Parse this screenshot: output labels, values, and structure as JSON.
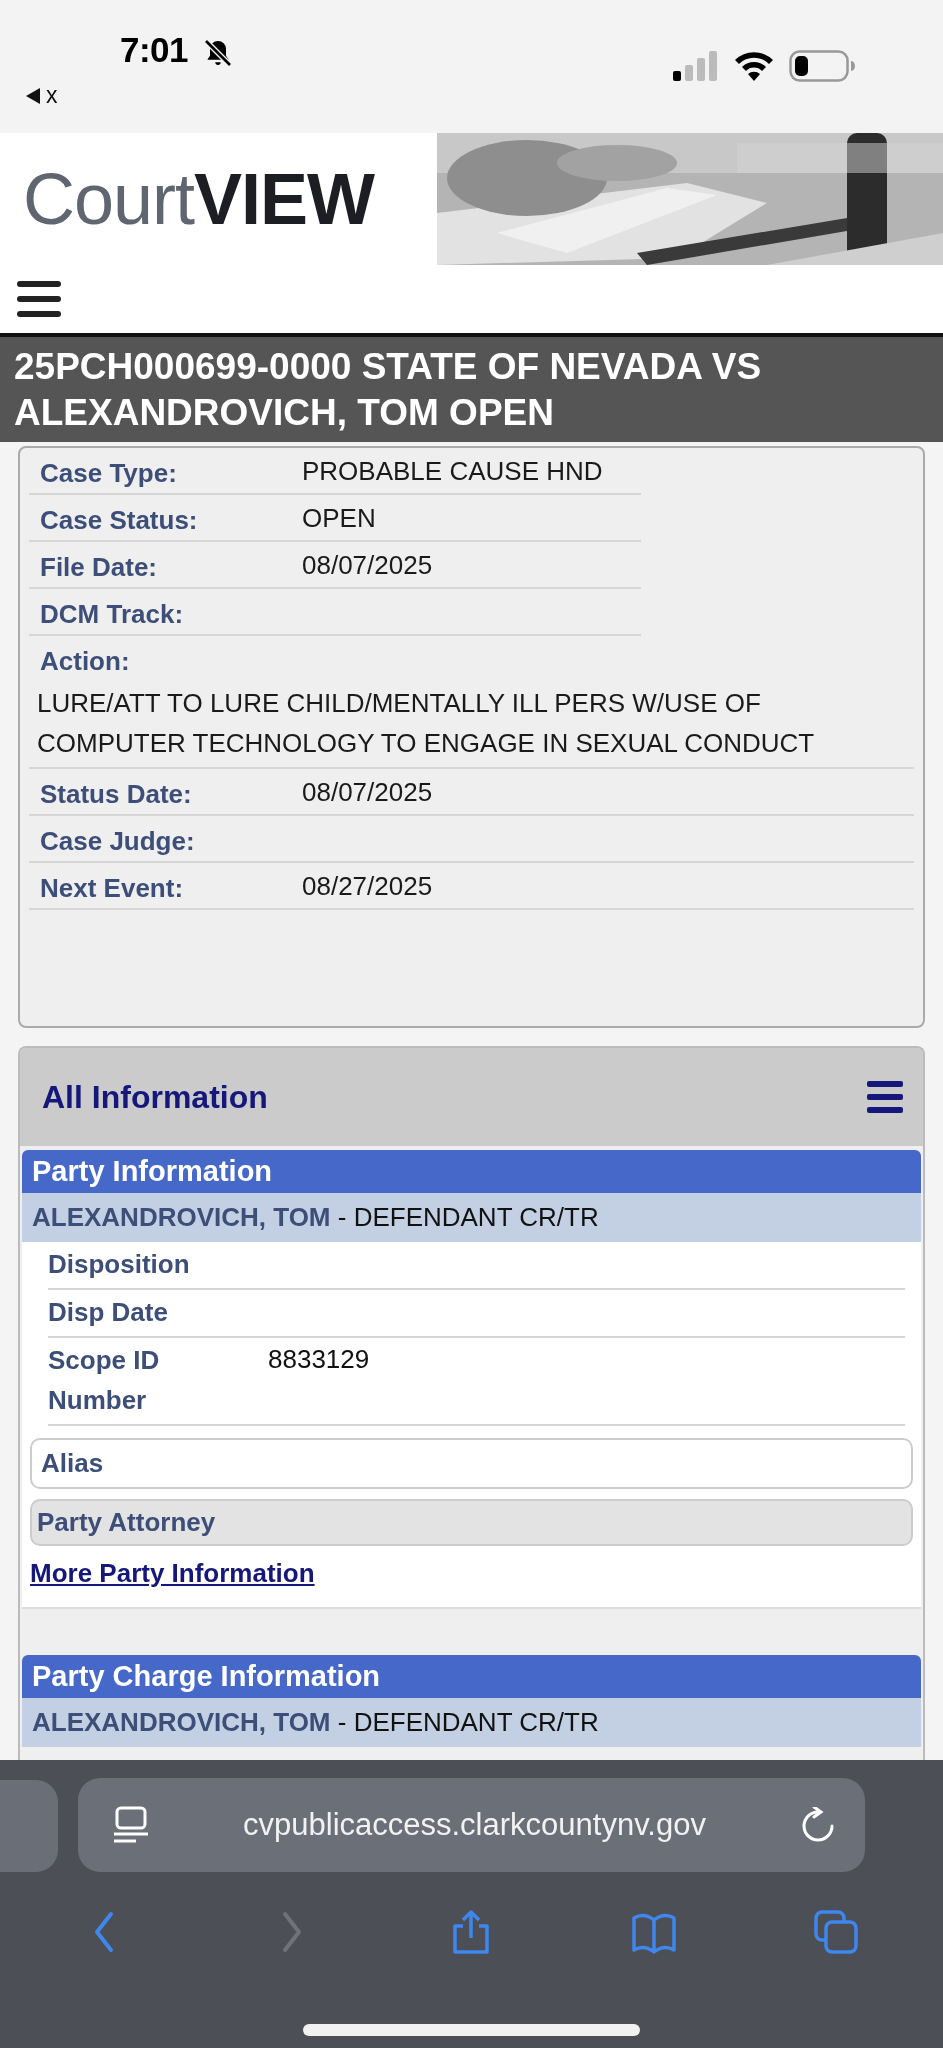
{
  "status_bar": {
    "time": "7:01",
    "back_app": "x"
  },
  "header": {
    "logo": "Court**VIEW**"
  },
  "case_title": "25PCH000699-0000 STATE OF NEVADA VS ALEXANDROVICH, TOM OPEN",
  "case_details": [
    {
      "kind": "short",
      "label": "Case Type:",
      "value": "PROBABLE CAUSE HND"
    },
    {
      "kind": "short",
      "label": "Case Status:",
      "value": "OPEN"
    },
    {
      "kind": "short",
      "label": "File Date:",
      "value": "08/07/2025"
    },
    {
      "kind": "short",
      "label": "DCM Track:"
    },
    {
      "kind": "block",
      "label": "Action:",
      "value": "LURE/ATT TO LURE CHILD/MENTALLY ILL PERS W/USE OF COMPUTER TECHNOLOGY TO ENGAGE IN SEXUAL CONDUCT"
    },
    {
      "kind": "full",
      "label": "Status Date:",
      "value": "08/07/2025"
    },
    {
      "kind": "full",
      "label": "Case Judge:"
    },
    {
      "kind": "full",
      "label": "Next Event:",
      "value": "08/27/2025"
    }
  ],
  "all_information": {
    "title": "All Information",
    "sections": [
      {
        "title": "Party Information",
        "party_name": "ALEXANDROVICH, TOM",
        "party_role": " - DEFENDANT CR/TR",
        "fields": [
          {
            "label": "Disposition"
          },
          {
            "label": "Disp Date"
          },
          {
            "label": "Scope ID Number",
            "value": "8833129"
          }
        ],
        "alias": "Alias",
        "attorney": "Party Attorney",
        "link": "More Party Information"
      },
      {
        "title": "Party Charge Information",
        "party_name": "ALEXANDROVICH, TOM",
        "party_role": " - DEFENDANT CR/TR"
      }
    ]
  },
  "browser": {
    "url": "cvpublicaccess.clarkcountynv.gov",
    "buttons": [
      {
        "kind": "back",
        "disabled": false
      },
      {
        "kind": "forward",
        "disabled": true
      },
      {
        "kind": "share",
        "disabled": false
      },
      {
        "kind": "bookmarks",
        "disabled": false
      },
      {
        "kind": "tabs",
        "disabled": false
      }
    ]
  }
}
